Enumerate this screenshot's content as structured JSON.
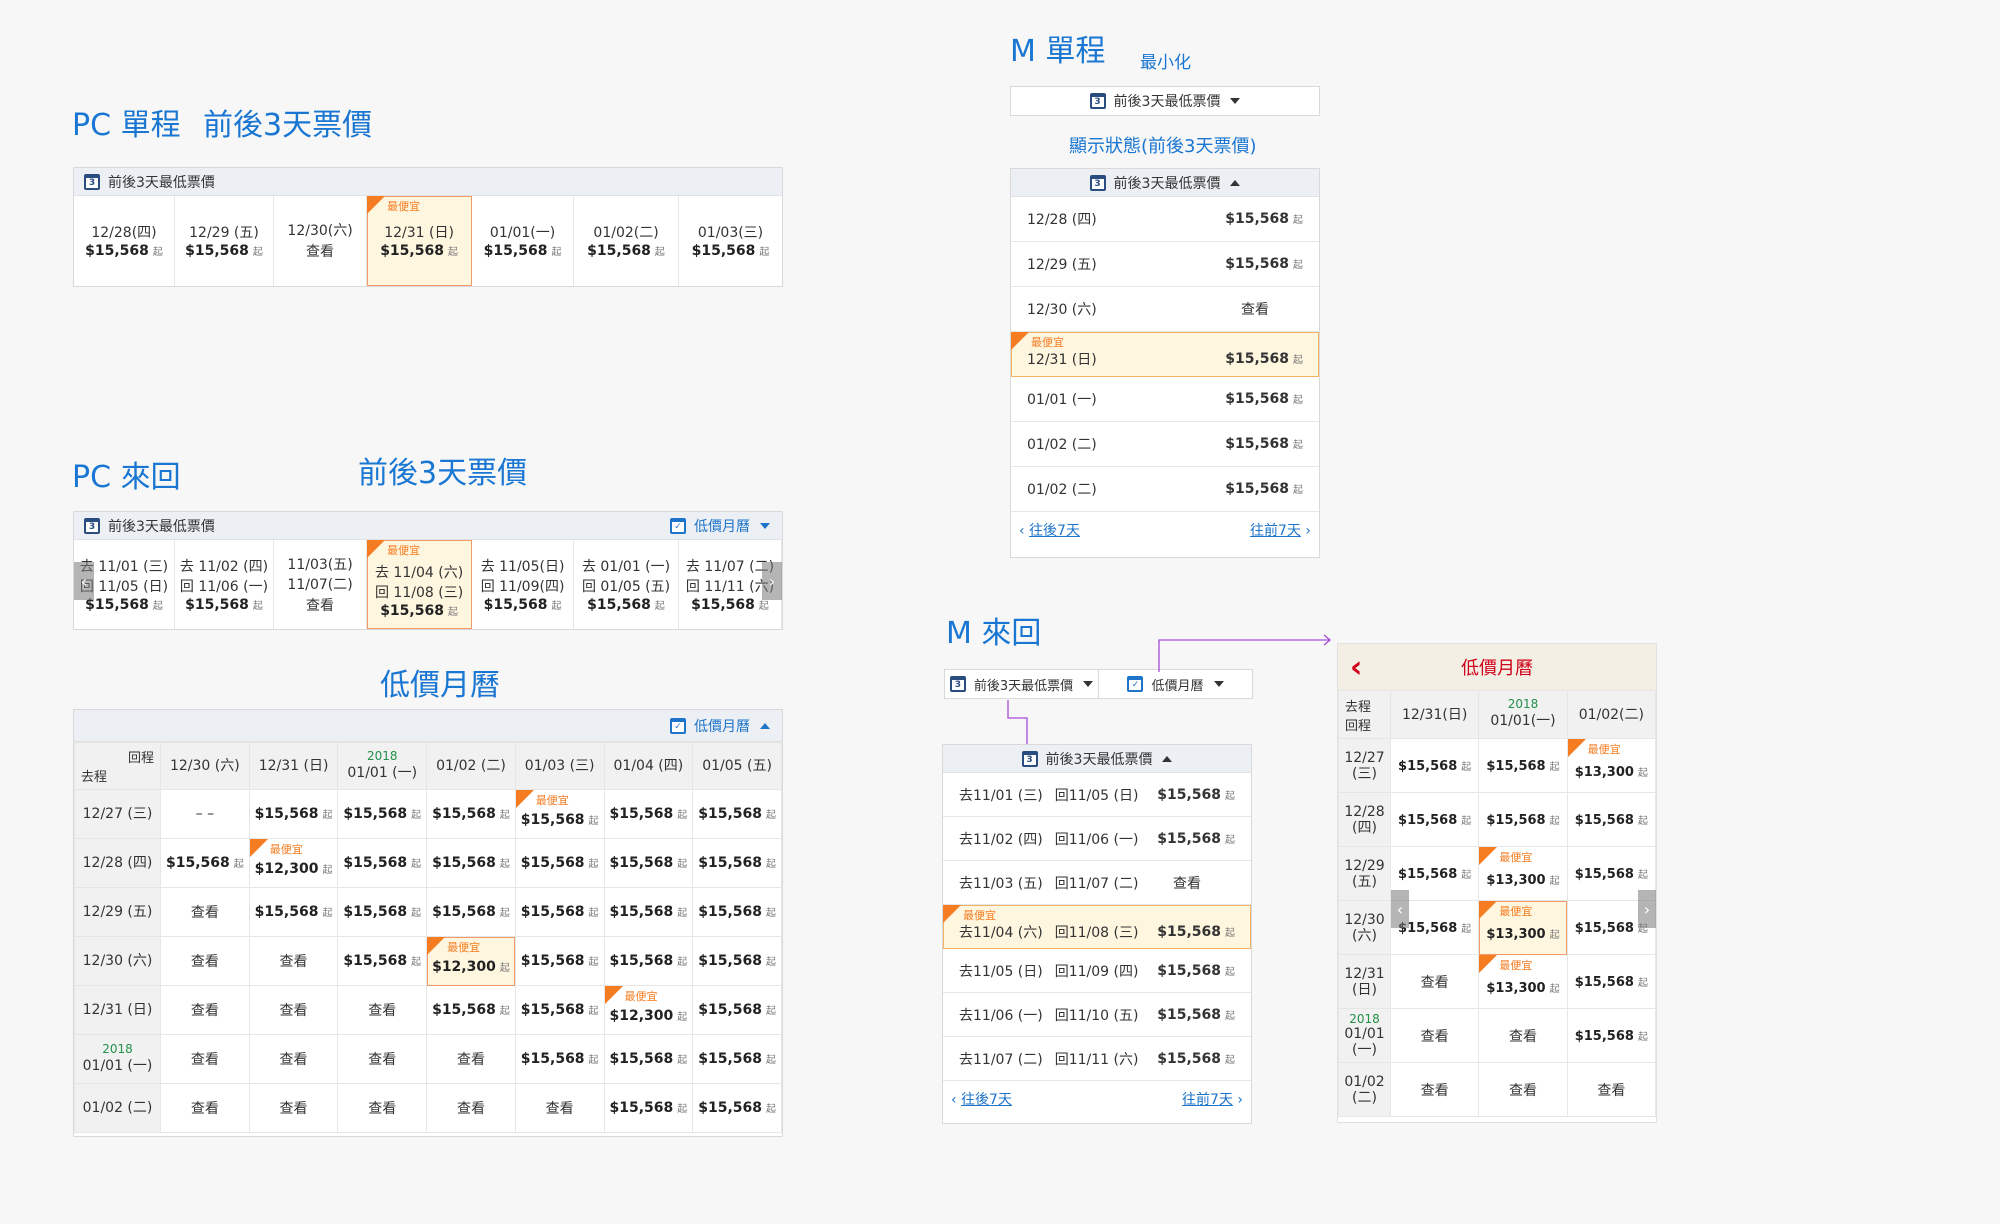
{
  "labels": {
    "pc_oneway": "PC 單程",
    "pc_oneway_sub": "前後3天票價",
    "pc_round": "PC 來回",
    "pc_round_sub": "前後3天票價",
    "pc_month": "低價月曆",
    "m_oneway": "M 單程",
    "m_minimize": "最小化",
    "m_display": "顯示狀態(前後3天票價)",
    "m_round": "M 來回"
  },
  "common": {
    "lowest_3day": "前後3天最低票價",
    "low_calendar": "低價月曆",
    "cheapest": "最便宜",
    "view": "查看",
    "from": "起",
    "prev7": "往後7天",
    "next7": "往前7天",
    "go_back_label": "回程",
    "go_label": "去程",
    "year": "2018"
  },
  "pc_oneway": [
    {
      "date": "12/28(四)",
      "price": "$15,568"
    },
    {
      "date": "12/29 (五)",
      "price": "$15,568"
    },
    {
      "date": "12/30(六)",
      "price": null
    },
    {
      "date": "12/31 (日)",
      "price": "$15,568",
      "cheapest": true
    },
    {
      "date": "01/01(一)",
      "price": "$15,568"
    },
    {
      "date": "01/02(二)",
      "price": "$15,568"
    },
    {
      "date": "01/03(三)",
      "price": "$15,568"
    }
  ],
  "pc_round": [
    {
      "go": "去 11/01 (三)",
      "back": "回 11/05 (日)",
      "price": "$15,568"
    },
    {
      "go": "去 11/02 (四)",
      "back": "回 11/06 (一)",
      "price": "$15,568"
    },
    {
      "go": "11/03(五)",
      "back": "11/07(二)",
      "price": null
    },
    {
      "go": "去 11/04 (六)",
      "back": "回 11/08 (三)",
      "price": "$15,568",
      "cheapest": true
    },
    {
      "go": "去 11/05(日)",
      "back": "回 11/09(四)",
      "price": "$15,568"
    },
    {
      "go": "去 01/01 (一)",
      "back": "回 01/05 (五)",
      "price": "$15,568"
    },
    {
      "go": "去 11/07 (二)",
      "back": "回 11/11 (六)",
      "price": "$15,568"
    }
  ],
  "pc_month": {
    "cols": [
      "12/30 (六)",
      "12/31 (日)",
      "01/01 (一)",
      "01/02 (二)",
      "01/03 (三)",
      "01/04 (四)",
      "01/05 (五)"
    ],
    "rows": [
      {
        "label": "12/27 (三)",
        "cells": [
          "– –",
          "$15,568",
          "$15,568",
          "$15,568",
          "$15,568*",
          "$15,568",
          "$15,568"
        ]
      },
      {
        "label": "12/28 (四)",
        "cells": [
          "$15,568",
          "$12,300*",
          "$15,568",
          "$15,568",
          "$15,568",
          "$15,568",
          "$15,568"
        ]
      },
      {
        "label": "12/29 (五)",
        "cells": [
          "查看",
          "$15,568",
          "$15,568",
          "$15,568",
          "$15,568",
          "$15,568",
          "$15,568"
        ]
      },
      {
        "label": "12/30 (六)",
        "cells": [
          "查看",
          "查看",
          "$15,568",
          "$12,300*H",
          "$15,568",
          "$15,568",
          "$15,568"
        ]
      },
      {
        "label": "12/31 (日)",
        "cells": [
          "查看",
          "查看",
          "查看",
          "$15,568",
          "$15,568",
          "$12,300*",
          "$15,568"
        ]
      },
      {
        "label": "01/01 (一)",
        "year": true,
        "cells": [
          "查看",
          "查看",
          "查看",
          "查看",
          "$15,568",
          "$15,568",
          "$15,568"
        ]
      },
      {
        "label": "01/02 (二)",
        "cells": [
          "查看",
          "查看",
          "查看",
          "查看",
          "查看",
          "$15,568",
          "$15,568"
        ]
      }
    ]
  },
  "m_oneway": [
    {
      "date": "12/28 (四)",
      "price": "$15,568"
    },
    {
      "date": "12/29 (五)",
      "price": "$15,568"
    },
    {
      "date": "12/30 (六)",
      "price": null
    },
    {
      "date": "12/31 (日)",
      "price": "$15,568",
      "cheapest": true
    },
    {
      "date": "01/01 (一)",
      "price": "$15,568"
    },
    {
      "date": "01/02 (二)",
      "price": "$15,568"
    },
    {
      "date": "01/02 (二)",
      "price": "$15,568"
    }
  ],
  "m_round": [
    {
      "go": "去11/01 (三)",
      "back": "回11/05 (日)",
      "price": "$15,568"
    },
    {
      "go": "去11/02 (四)",
      "back": "回11/06 (一)",
      "price": "$15,568"
    },
    {
      "go": "去11/03 (五)",
      "back": "回11/07 (二)",
      "price": null
    },
    {
      "go": "去11/04 (六)",
      "back": "回11/08 (三)",
      "price": "$15,568",
      "cheapest": true
    },
    {
      "go": "去11/05 (日)",
      "back": "回11/09 (四)",
      "price": "$15,568"
    },
    {
      "go": "去11/06 (一)",
      "back": "回11/10 (五)",
      "price": "$15,568"
    },
    {
      "go": "去11/07 (二)",
      "back": "回11/11 (六)",
      "price": "$15,568"
    }
  ],
  "m_month": {
    "cols": [
      "12/31(日)",
      "01/01(一)",
      "01/02(二)"
    ],
    "rows": [
      {
        "label": "12/27 (三)",
        "cells": [
          "$15,568",
          "$15,568",
          "$13,300*"
        ]
      },
      {
        "label": "12/28 (四)",
        "cells": [
          "$15,568",
          "$15,568",
          "$15,568"
        ]
      },
      {
        "label": "12/29 (五)",
        "cells": [
          "$15,568",
          "$13,300*",
          "$15,568"
        ]
      },
      {
        "label": "12/30 (六)",
        "cells": [
          "$15,568",
          "$13,300*H",
          "$15,568"
        ]
      },
      {
        "label": "12/31 (日)",
        "cells": [
          "查看",
          "$13,300*",
          "$15,568"
        ]
      },
      {
        "label": "01/01 (一)",
        "year": true,
        "cells": [
          "查看",
          "查看",
          "$15,568"
        ]
      },
      {
        "label": "01/02 (二)",
        "cells": [
          "查看",
          "查看",
          "查看"
        ]
      }
    ]
  }
}
